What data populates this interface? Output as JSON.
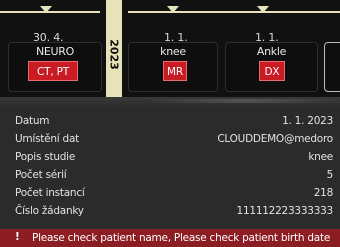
{
  "timeline": {
    "year": "2023",
    "studies": [
      {
        "date": "30. 4.",
        "title": "NEURO",
        "modality": "CT, PT"
      },
      {
        "date": "1. 1.",
        "title": "knee",
        "modality": "MR"
      },
      {
        "date": "1. 1.",
        "title": "Ankle",
        "modality": "DX"
      }
    ]
  },
  "details": {
    "rows": [
      {
        "label": "Datum",
        "value": "1. 1. 2023"
      },
      {
        "label": "Umístění dat",
        "value": "CLOUDDEMO@medoro"
      },
      {
        "label": "Popis studie",
        "value": "knee"
      },
      {
        "label": "Počet sérií",
        "value": "5"
      },
      {
        "label": "Počet instancí",
        "value": "218"
      },
      {
        "label": "Číslo žádanky",
        "value": "111112223333333"
      }
    ]
  },
  "warning": {
    "icon": "!",
    "message": "Please check patient name, Please check patient birth date"
  }
}
